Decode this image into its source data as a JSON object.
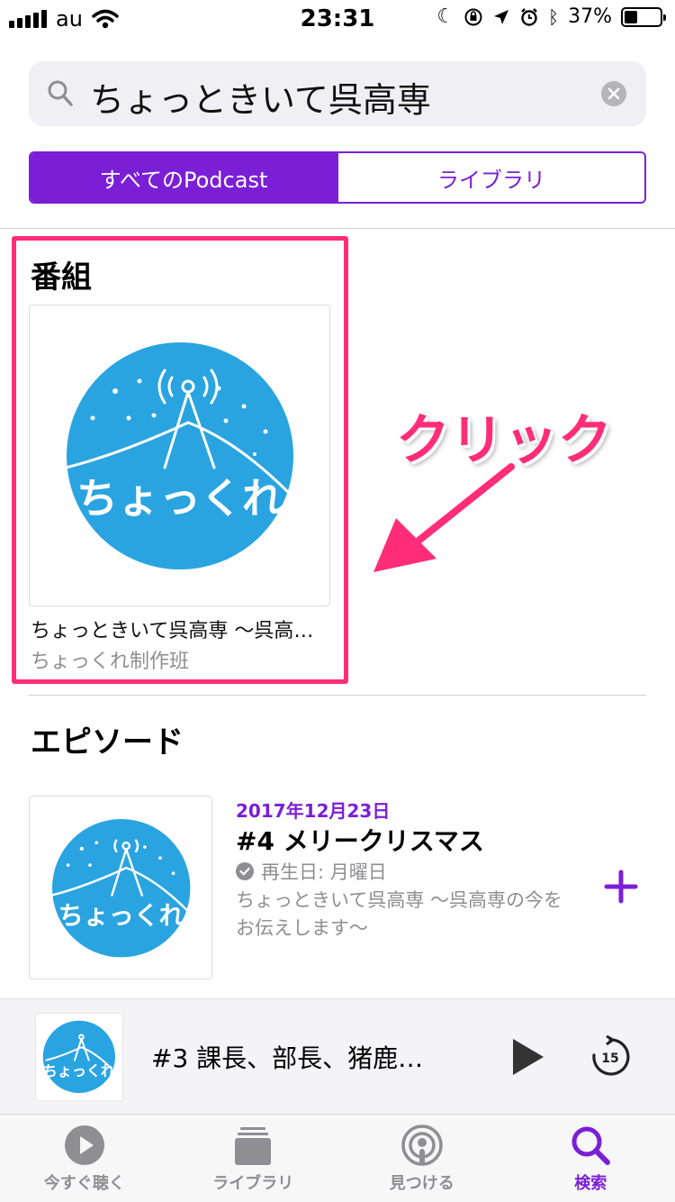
{
  "status_bar": {
    "carrier": "au",
    "time": "23:31",
    "battery": "37%",
    "battery_level": 0.37
  },
  "search": {
    "query": "ちょっときいて呉高専"
  },
  "segments": {
    "all": "すべてのPodcast",
    "library": "ライブラリ"
  },
  "shows": {
    "heading": "番組",
    "item": {
      "title": "ちょっときいて呉高専 〜呉高…",
      "author": "ちょっくれ制作班",
      "artwork_text": "ちょっくれ"
    }
  },
  "annotation": {
    "label": "クリック"
  },
  "episodes": {
    "heading": "エピソード",
    "item": {
      "date": "2017年12月23日",
      "title": "#4 メリークリスマス",
      "played": "再生日: 月曜日",
      "description": "ちょっときいて呉高専 〜呉高専の今をお伝えします〜"
    }
  },
  "mini_player": {
    "title": "#3 課長、部長、猪鹿…"
  },
  "tabs": [
    {
      "label": "今すぐ聴く",
      "icon": "play-circle-icon"
    },
    {
      "label": "ライブラリ",
      "icon": "library-stack-icon"
    },
    {
      "label": "見つける",
      "icon": "podcast-broadcast-icon"
    },
    {
      "label": "検索",
      "icon": "search-icon"
    }
  ],
  "colors": {
    "accent": "#7b1fd6",
    "highlight": "#ff2d78",
    "artwork_blue": "#2aa4e0"
  }
}
